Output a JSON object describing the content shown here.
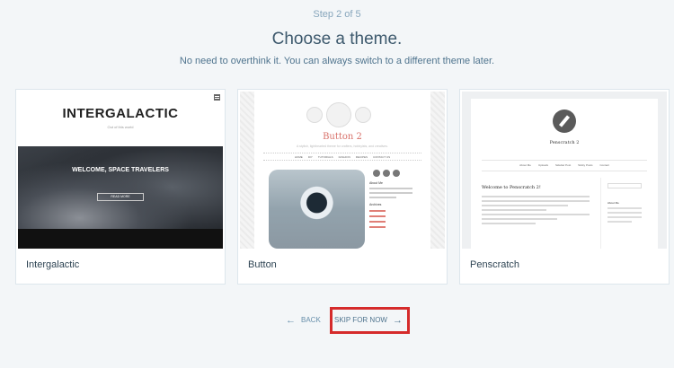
{
  "header": {
    "step": "Step 2 of 5",
    "title": "Choose a theme.",
    "subtitle": "No need to overthink it. You can always switch to a different theme later."
  },
  "themes": [
    {
      "name": "Intergalactic",
      "preview": {
        "logo": "INTERGALACTIC",
        "tagline": "Out of this world",
        "hero_heading": "WELCOME, SPACE TRAVELERS",
        "button": "READ MORE"
      }
    },
    {
      "name": "Button",
      "preview": {
        "title": "Button 2",
        "tagline": "A stylish, lighthearted theme for crafters, hobbyists, and creatives.",
        "nav": [
          "HOME",
          "DIY",
          "TUTORIALS",
          "FASHION",
          "RECIPES",
          "CONTACT US"
        ],
        "sidebar_heading": "About Me",
        "archive_heading": "Archives"
      }
    },
    {
      "name": "Penscratch",
      "preview": {
        "title": "Penscratch 2",
        "nav": [
          "About Me",
          "Uploads",
          "Sidebar Post",
          "Sticky Posts",
          "Contact"
        ],
        "post_title": "Welcome to Penscratch 2!",
        "sidebar_heading": "About Me"
      }
    }
  ],
  "footer": {
    "back_label": "BACK",
    "skip_label": "SKIP FOR NOW",
    "back_icon": "arrow-left-icon",
    "skip_icon": "arrow-right-icon"
  },
  "colors": {
    "highlight_border": "#d52b2b",
    "link": "#668eaa"
  }
}
